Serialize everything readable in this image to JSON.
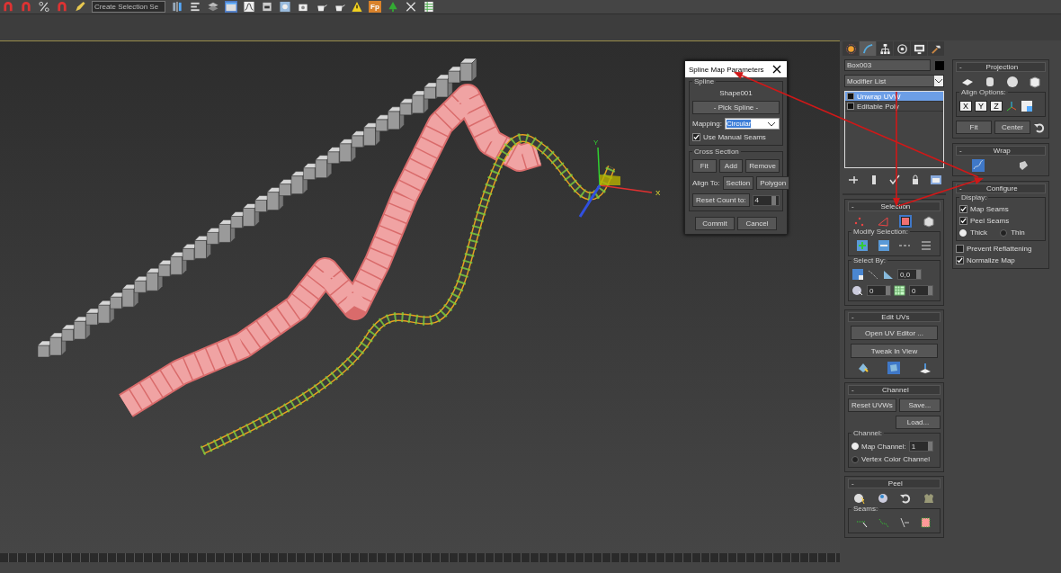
{
  "toolbar": {
    "selection_set": "Create Selection Se",
    "plugin_label": "Fp"
  },
  "viewport": {
    "gizmo": {
      "x_label": "X",
      "y_label": "Y"
    }
  },
  "dialog": {
    "title": "Spline Map Parameters",
    "spline_group": "Spline",
    "shape_name": "Shape001",
    "pick_button": "- Pick Spline -",
    "mapping_label": "Mapping:",
    "mapping_value": "Circular",
    "use_manual_seams": {
      "label": "Use Manual Seams",
      "checked": true
    },
    "cross_section_group": "Cross Section",
    "cross_buttons": [
      "Fit",
      "Add",
      "Remove"
    ],
    "align_label": "Align To:",
    "align_buttons": [
      "Section",
      "Polygon"
    ],
    "reset_label": "Reset Count to:",
    "reset_value": "4",
    "actions": [
      "Commit",
      "Cancel"
    ]
  },
  "command_panel": {
    "tabs": [
      {
        "kind": "create",
        "selected": false
      },
      {
        "kind": "modify",
        "selected": true
      },
      {
        "kind": "hierarchy",
        "selected": false
      },
      {
        "kind": "motion",
        "selected": false
      },
      {
        "kind": "display",
        "selected": false
      },
      {
        "kind": "utilities",
        "selected": false
      }
    ],
    "object_name": "Box003",
    "modifier_list": "Modifier List",
    "stack": [
      {
        "label": "Unwrap UVW",
        "selected": true
      },
      {
        "label": "Editable Poly",
        "selected": false
      }
    ],
    "selection": {
      "collapse": "-",
      "title": "Selection",
      "modes": [
        {
          "kind": "vertex",
          "selected": false
        },
        {
          "kind": "edge",
          "selected": false
        },
        {
          "kind": "face",
          "selected": true
        }
      ],
      "modify_label": "Modify Selection:",
      "select_by_label": "Select By:",
      "angle_value": "0,0",
      "spin_values": [
        "0",
        "0"
      ]
    },
    "edit_uvs": {
      "collapse": "-",
      "title": "Edit UVs",
      "buttons": [
        "Open UV Editor ...",
        "Tweak In View"
      ],
      "tools": [
        {
          "selected": false
        },
        {
          "selected": true
        },
        {
          "selected": false
        }
      ]
    },
    "channel": {
      "collapse": "-",
      "title": "Channel",
      "reset_button": "Reset UVWs",
      "save_button": "Save...",
      "load_button": "Load...",
      "group": "Channel:",
      "radios": [
        {
          "label": "Map Channel:",
          "selected": true
        },
        {
          "label": "Vertex Color Channel",
          "selected": false
        }
      ],
      "map_channel_value": "1"
    },
    "peel": {
      "collapse": "-",
      "title": "Peel",
      "seams_label": "Seams:"
    }
  },
  "right_panel": {
    "projection": {
      "collapse": "-",
      "title": "Projection",
      "align_label": "Align Options:",
      "axes": [
        "X",
        "Y",
        "Z"
      ],
      "buttons": [
        "Fit",
        "Center"
      ]
    },
    "wrap": {
      "collapse": "-",
      "title": "Wrap",
      "tools": [
        {
          "selected": true
        },
        {
          "selected": false
        }
      ]
    },
    "configure": {
      "collapse": "-",
      "title": "Configure",
      "display_label": "Display:",
      "checks": [
        {
          "label": "Map Seams",
          "checked": true
        },
        {
          "label": "Peel Seams",
          "checked": true
        }
      ],
      "thickness": [
        {
          "label": "Thick",
          "selected": true
        },
        {
          "label": "Thin",
          "selected": false
        }
      ],
      "options": [
        {
          "label": "Prevent Reflattening",
          "checked": false
        },
        {
          "label": "Normalize Map",
          "checked": true
        }
      ]
    }
  }
}
